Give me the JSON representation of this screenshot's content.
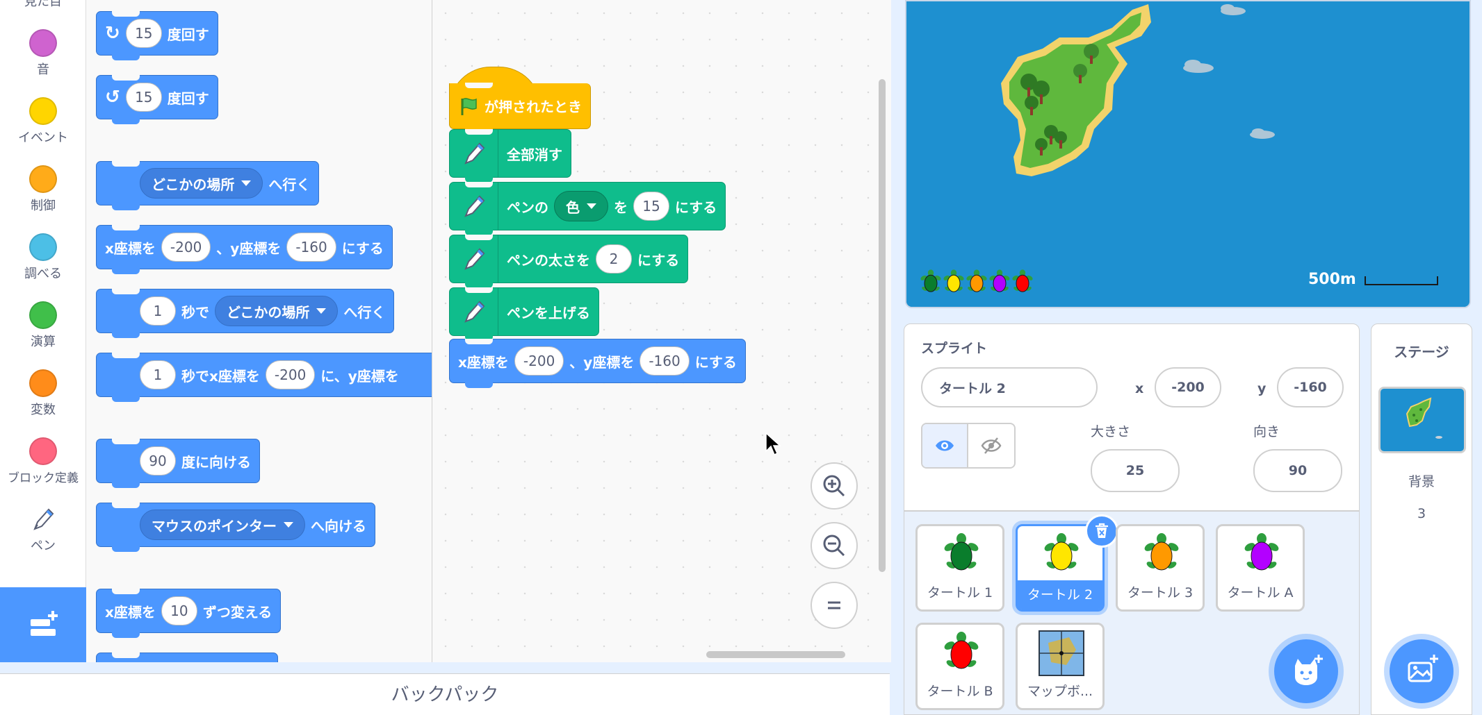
{
  "categories": [
    {
      "label": "見た目",
      "color": "#9966ff"
    },
    {
      "label": "音",
      "color": "#cf63cf"
    },
    {
      "label": "イベント",
      "color": "#ffd500"
    },
    {
      "label": "制御",
      "color": "#ffab19"
    },
    {
      "label": "調べる",
      "color": "#4cbfe6"
    },
    {
      "label": "演算",
      "color": "#40bf4a"
    },
    {
      "label": "変数",
      "color": "#ff8c1a"
    },
    {
      "label": "ブロック定義",
      "color": "#ff6680"
    },
    {
      "label": "ペン",
      "color": "#0fbd8c"
    }
  ],
  "palette": {
    "turn_right": {
      "value": "15",
      "text": "度回す"
    },
    "turn_left": {
      "value": "15",
      "text": "度回す"
    },
    "goto": {
      "dropdown": "どこかの場所",
      "text": "へ行く"
    },
    "gotoxy": {
      "pre": "x座標を",
      "x": "-200",
      "mid": "、y座標を",
      "y": "-160",
      "post": "にする"
    },
    "glide_to": {
      "value": "1",
      "text1": "秒で",
      "dropdown": "どこかの場所",
      "text2": "へ行く"
    },
    "glide_xy": {
      "value": "1",
      "text1": "秒でx座標を",
      "x": "-200",
      "text2": "に、y座標を"
    },
    "point_dir": {
      "value": "90",
      "text": "度に向ける"
    },
    "point_towards": {
      "dropdown": "マウスのポインター",
      "text": "へ向ける"
    },
    "change_x": {
      "pre": "x座標を",
      "value": "10",
      "post": "ずつ変える"
    }
  },
  "script": {
    "hat": "が押されたとき",
    "clear": "全部消す",
    "set_color": {
      "pre": "ペンの",
      "dropdown": "色",
      "mid": "を",
      "value": "15",
      "post": "にする"
    },
    "set_size": {
      "pre": "ペンの太さを",
      "value": "2",
      "post": "にする"
    },
    "pen_up": "ペンを上げる",
    "gotoxy": {
      "pre": "x座標を",
      "x": "-200",
      "mid": "、y座標を",
      "y": "-160",
      "post": "にする"
    }
  },
  "backpack": "バックパック",
  "stage_scale": "500m",
  "stage_turtles": [
    "#0a7d2c",
    "#ffe600",
    "#ff9900",
    "#b300ff",
    "#ff0000"
  ],
  "sprite_info": {
    "title": "スプライト",
    "name": "タートル 2",
    "x_label": "x",
    "x": "-200",
    "y_label": "y",
    "y": "-160",
    "size_label": "大きさ",
    "size": "25",
    "direction_label": "向き",
    "direction": "90"
  },
  "sprites": [
    {
      "name": "タートル 1",
      "color": "#0a7d2c"
    },
    {
      "name": "タートル 2",
      "color": "#ffe600"
    },
    {
      "name": "タートル 3",
      "color": "#ff9900"
    },
    {
      "name": "タートル A",
      "color": "#b300ff"
    },
    {
      "name": "タートル B",
      "color": "#ff0000"
    },
    {
      "name": "マップボ..."
    }
  ],
  "stage_panel": {
    "title": "ステージ",
    "backdrop_label": "背景",
    "backdrop_count": "3"
  }
}
